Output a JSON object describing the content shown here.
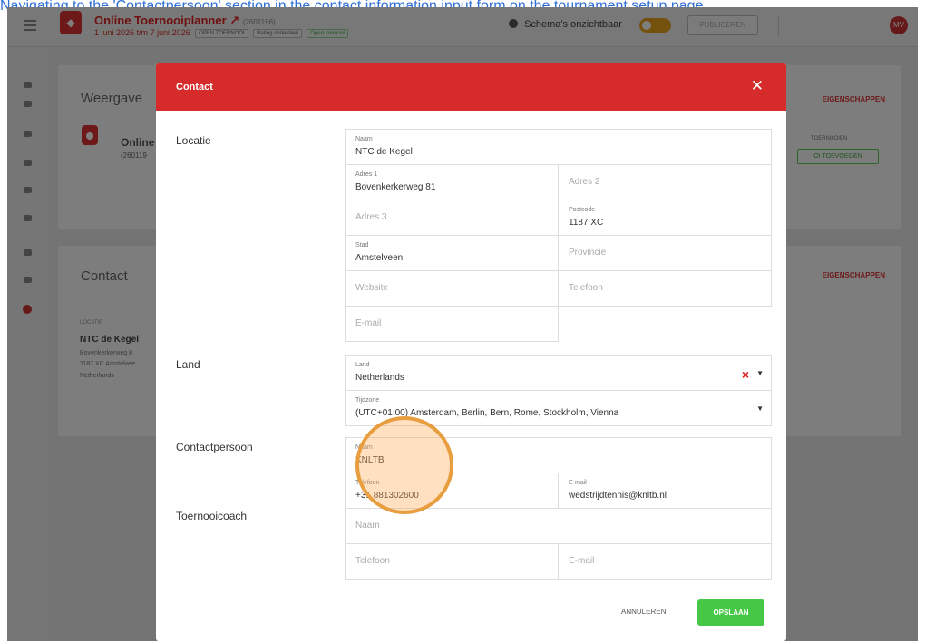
{
  "caption": {
    "text": "Navigating to the 'Contactpersoon' section in the contact information input form on the tournament setup page"
  },
  "header": {
    "tournament_name": "Online Toernooiplanner",
    "tournament_id": "(2601196)",
    "dates": "1 juni 2026 t/m 7 juni 2026",
    "tags": [
      "OPEN TOERNOOI",
      "Rating onderdeel",
      "Open toernooi"
    ],
    "visibility_text": "Schema's onzichtbaar",
    "publish_label": "PUBLICEREN",
    "avatar_initials": "MV"
  },
  "background": {
    "weergave_title": "Weergave",
    "eigenschappen_label": "EIGENSCHAPPEN",
    "online_name": "Online",
    "online_id": "(260119",
    "toernooien_label": "TOERNOOIEN",
    "toevoegen_label": "OI TOEVOEGEN",
    "contact_title": "Contact",
    "contact_link": "EIGENSCHAPPEN",
    "locatie_label": "LOCATIE",
    "club_name": "NTC de Kegel",
    "club_street": "Bovenkerkerweg 8",
    "club_city": "1187 XC Amstelvee",
    "club_country": "Netherlands"
  },
  "modal": {
    "title": "Contact",
    "close_icon": "✕",
    "sections": {
      "locatie": "Locatie",
      "land": "Land",
      "contactpersoon": "Contactpersoon",
      "toernooicoach": "Toernooicoach"
    },
    "location": {
      "naam_label": "Naam",
      "naam_value": "NTC de Kegel",
      "adres1_label": "Adres 1",
      "adres1_value": "Bovenkerkerweg 81",
      "adres2_placeholder": "Adres 2",
      "adres3_placeholder": "Adres 3",
      "postcode_label": "Postcode",
      "postcode_value": "1187 XC",
      "stad_label": "Stad",
      "stad_value": "Amstelveen",
      "provincie_placeholder": "Provincie",
      "website_placeholder": "Website",
      "telefoon_placeholder": "Telefoon",
      "email_placeholder": "E-mail"
    },
    "country": {
      "land_label": "Land",
      "land_value": "Netherlands",
      "tijdzone_label": "Tijdzone",
      "tijdzone_value": "(UTC+01:00) Amsterdam, Berlin, Bern, Rome, Stockholm, Vienna"
    },
    "contact_person": {
      "naam_label": "Naam",
      "naam_value": "KNLTB",
      "telefoon_label": "Telefoon",
      "telefoon_value": "+31 881302600",
      "email_label": "E-mail",
      "email_value": "wedstrijdtennis@knltb.nl"
    },
    "coach": {
      "naam_placeholder": "Naam",
      "telefoon_placeholder": "Telefoon",
      "email_placeholder": "E-mail"
    },
    "cancel_label": "ANNULEREN",
    "save_label": "OPSLAAN"
  },
  "colors": {
    "header_red": "#d62b2b",
    "save_green": "#46c746",
    "cursor_orange": "#e89d3f"
  }
}
